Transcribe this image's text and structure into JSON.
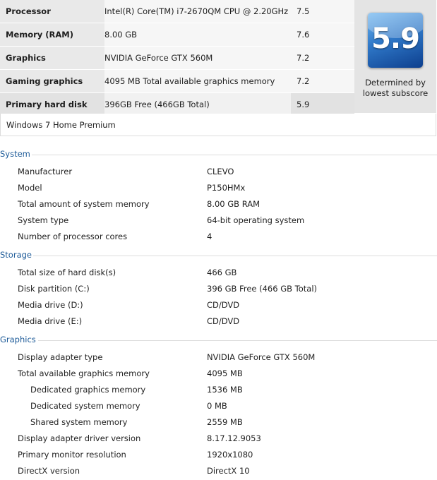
{
  "scores": [
    {
      "component": "Processor",
      "detail": "Intel(R) Core(TM) i7-2670QM CPU @ 2.20GHz",
      "subscore": "7.5"
    },
    {
      "component": "Memory (RAM)",
      "detail": "8.00 GB",
      "subscore": "7.6"
    },
    {
      "component": "Graphics",
      "detail": "NVIDIA GeForce GTX 560M",
      "subscore": "7.2"
    },
    {
      "component": "Gaming graphics",
      "detail": "4095 MB Total available graphics memory",
      "subscore": "7.2"
    },
    {
      "component": "Primary hard disk",
      "detail": "396GB Free (466GB Total)",
      "subscore": "5.9"
    }
  ],
  "base_score": {
    "value": "5.9",
    "caption_line1": "Determined by",
    "caption_line2": "lowest subscore"
  },
  "edition": "Windows 7 Home Premium",
  "sections": {
    "system": {
      "title": "System",
      "rows": [
        {
          "label": "Manufacturer",
          "value": "CLEVO"
        },
        {
          "label": "Model",
          "value": "P150HMx"
        },
        {
          "label": "Total amount of system memory",
          "value": "8.00 GB RAM"
        },
        {
          "label": "System type",
          "value": "64-bit operating system"
        },
        {
          "label": "Number of processor cores",
          "value": "4"
        }
      ]
    },
    "storage": {
      "title": "Storage",
      "rows": [
        {
          "label": "Total size of hard disk(s)",
          "value": "466 GB"
        },
        {
          "label": "Disk partition (C:)",
          "value": "396 GB Free (466 GB Total)"
        },
        {
          "label": "Media drive (D:)",
          "value": "CD/DVD"
        },
        {
          "label": "Media drive (E:)",
          "value": "CD/DVD"
        }
      ]
    },
    "graphics": {
      "title": "Graphics",
      "rows": [
        {
          "label": "Display adapter type",
          "value": "NVIDIA GeForce GTX 560M"
        },
        {
          "label": "Total available graphics memory",
          "value": "4095 MB"
        },
        {
          "label": "Dedicated graphics memory",
          "value": "1536 MB"
        },
        {
          "label": "Dedicated system memory",
          "value": "0 MB"
        },
        {
          "label": "Shared system memory",
          "value": "2559 MB"
        },
        {
          "label": "Display adapter driver version",
          "value": "8.17.12.9053"
        },
        {
          "label": "Primary monitor resolution",
          "value": "1920x1080"
        },
        {
          "label": "DirectX version",
          "value": "DirectX 10"
        }
      ]
    }
  }
}
